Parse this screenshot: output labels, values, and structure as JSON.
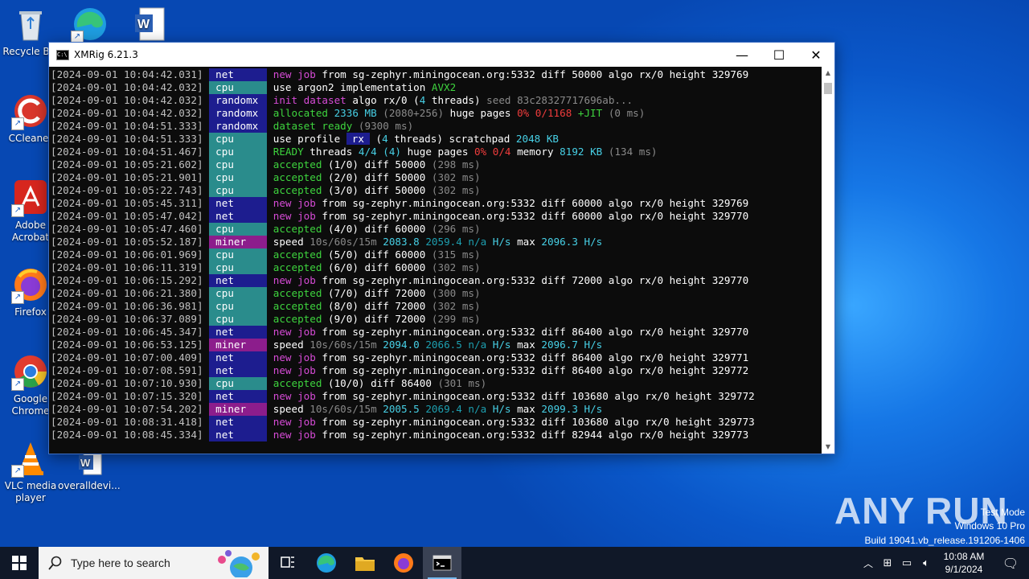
{
  "desktop": {
    "icons": [
      {
        "label": "Recycle Bin"
      },
      {
        "label": ""
      },
      {
        "label": ""
      },
      {
        "label": "CCleaner"
      },
      {
        "label": "Adobe Acrobat"
      },
      {
        "label": "Firefox"
      },
      {
        "label": "Google Chrome"
      },
      {
        "label": "VLC media player"
      },
      {
        "label": "overalldevi..."
      }
    ]
  },
  "window": {
    "title": "XMRig 6.21.3",
    "minimize": "—",
    "maximize": "☐",
    "close": "✕"
  },
  "log": [
    {
      "ts": "[2024-09-01 10:04:42.031]",
      "tag": "net",
      "parts": [
        [
          "new job",
          "mag"
        ],
        [
          " from sg-zephyr.miningocean.org:5332 diff ",
          "wht"
        ],
        [
          "50000",
          "wht"
        ],
        [
          " algo rx/0 height ",
          "wht"
        ],
        [
          "329769",
          "wht"
        ]
      ]
    },
    {
      "ts": "[2024-09-01 10:04:42.032]",
      "tag": "cpu",
      "parts": [
        [
          "use argon2 implementation ",
          "wht"
        ],
        [
          "AVX2",
          "grn"
        ]
      ]
    },
    {
      "ts": "[2024-09-01 10:04:42.032]",
      "tag": "randomx",
      "parts": [
        [
          "init dataset",
          "mag"
        ],
        [
          " algo rx/0 (",
          "wht"
        ],
        [
          "4",
          "cyn"
        ],
        [
          " threads) ",
          "wht"
        ],
        [
          "seed 83c28327717696ab...",
          "gry"
        ]
      ]
    },
    {
      "ts": "[2024-09-01 10:04:42.032]",
      "tag": "randomx",
      "parts": [
        [
          "allocated ",
          "grn"
        ],
        [
          "2336 MB",
          "cyn"
        ],
        [
          " (2080+256)",
          "gry"
        ],
        [
          " huge pages ",
          "wht"
        ],
        [
          "0% 0/1168",
          "red"
        ],
        [
          " +JIT",
          "grn"
        ],
        [
          " (0 ms)",
          "gry"
        ]
      ]
    },
    {
      "ts": "[2024-09-01 10:04:51.333]",
      "tag": "randomx",
      "parts": [
        [
          "dataset ready",
          "grn"
        ],
        [
          " (9300 ms)",
          "gry"
        ]
      ]
    },
    {
      "ts": "[2024-09-01 10:04:51.333]",
      "tag": "cpu",
      "parts": [
        [
          "use profile ",
          "wht"
        ],
        [
          "rx",
          "box"
        ],
        [
          " (",
          "wht"
        ],
        [
          "4",
          "cyn"
        ],
        [
          " threads) scratchpad ",
          "wht"
        ],
        [
          "2048 KB",
          "cyn"
        ]
      ]
    },
    {
      "ts": "[2024-09-01 10:04:51.467]",
      "tag": "cpu",
      "parts": [
        [
          "READY",
          "grn"
        ],
        [
          " threads ",
          "wht"
        ],
        [
          "4/4 (4)",
          "cyn"
        ],
        [
          " huge pages ",
          "wht"
        ],
        [
          "0% 0/4",
          "red"
        ],
        [
          " memory ",
          "wht"
        ],
        [
          "8192 KB",
          "cyn"
        ],
        [
          " (134 ms)",
          "gry"
        ]
      ]
    },
    {
      "ts": "[2024-09-01 10:05:21.602]",
      "tag": "cpu",
      "parts": [
        [
          "accepted",
          "grn"
        ],
        [
          " (1/0) diff ",
          "wht"
        ],
        [
          "50000",
          "wht"
        ],
        [
          " (298 ms)",
          "gry"
        ]
      ]
    },
    {
      "ts": "[2024-09-01 10:05:21.901]",
      "tag": "cpu",
      "parts": [
        [
          "accepted",
          "grn"
        ],
        [
          " (2/0) diff ",
          "wht"
        ],
        [
          "50000",
          "wht"
        ],
        [
          " (302 ms)",
          "gry"
        ]
      ]
    },
    {
      "ts": "[2024-09-01 10:05:22.743]",
      "tag": "cpu",
      "parts": [
        [
          "accepted",
          "grn"
        ],
        [
          " (3/0) diff ",
          "wht"
        ],
        [
          "50000",
          "wht"
        ],
        [
          " (302 ms)",
          "gry"
        ]
      ]
    },
    {
      "ts": "[2024-09-01 10:05:45.311]",
      "tag": "net",
      "parts": [
        [
          "new job",
          "mag"
        ],
        [
          " from sg-zephyr.miningocean.org:5332 diff ",
          "wht"
        ],
        [
          "60000",
          "wht"
        ],
        [
          " algo rx/0 height ",
          "wht"
        ],
        [
          "329769",
          "wht"
        ]
      ]
    },
    {
      "ts": "[2024-09-01 10:05:47.042]",
      "tag": "net",
      "parts": [
        [
          "new job",
          "mag"
        ],
        [
          " from sg-zephyr.miningocean.org:5332 diff ",
          "wht"
        ],
        [
          "60000",
          "wht"
        ],
        [
          " algo rx/0 height ",
          "wht"
        ],
        [
          "329770",
          "wht"
        ]
      ]
    },
    {
      "ts": "[2024-09-01 10:05:47.460]",
      "tag": "cpu",
      "parts": [
        [
          "accepted",
          "grn"
        ],
        [
          " (4/0) diff ",
          "wht"
        ],
        [
          "60000",
          "wht"
        ],
        [
          " (296 ms)",
          "gry"
        ]
      ]
    },
    {
      "ts": "[2024-09-01 10:05:52.187]",
      "tag": "miner",
      "parts": [
        [
          "speed ",
          "wht"
        ],
        [
          "10s/60s/15m ",
          "gry"
        ],
        [
          "2083.8",
          "cyn"
        ],
        [
          " 2059.4 n/a",
          "dcy"
        ],
        [
          " H/s",
          "cyn"
        ],
        [
          " max ",
          "wht"
        ],
        [
          "2096.3 H/s",
          "cyn"
        ]
      ]
    },
    {
      "ts": "[2024-09-01 10:06:01.969]",
      "tag": "cpu",
      "parts": [
        [
          "accepted",
          "grn"
        ],
        [
          " (5/0) diff ",
          "wht"
        ],
        [
          "60000",
          "wht"
        ],
        [
          " (315 ms)",
          "gry"
        ]
      ]
    },
    {
      "ts": "[2024-09-01 10:06:11.319]",
      "tag": "cpu",
      "parts": [
        [
          "accepted",
          "grn"
        ],
        [
          " (6/0) diff ",
          "wht"
        ],
        [
          "60000",
          "wht"
        ],
        [
          " (302 ms)",
          "gry"
        ]
      ]
    },
    {
      "ts": "[2024-09-01 10:06:15.292]",
      "tag": "net",
      "parts": [
        [
          "new job",
          "mag"
        ],
        [
          " from sg-zephyr.miningocean.org:5332 diff ",
          "wht"
        ],
        [
          "72000",
          "wht"
        ],
        [
          " algo rx/0 height ",
          "wht"
        ],
        [
          "329770",
          "wht"
        ]
      ]
    },
    {
      "ts": "[2024-09-01 10:06:21.380]",
      "tag": "cpu",
      "parts": [
        [
          "accepted",
          "grn"
        ],
        [
          " (7/0) diff ",
          "wht"
        ],
        [
          "72000",
          "wht"
        ],
        [
          " (300 ms)",
          "gry"
        ]
      ]
    },
    {
      "ts": "[2024-09-01 10:06:36.981]",
      "tag": "cpu",
      "parts": [
        [
          "accepted",
          "grn"
        ],
        [
          " (8/0) diff ",
          "wht"
        ],
        [
          "72000",
          "wht"
        ],
        [
          " (302 ms)",
          "gry"
        ]
      ]
    },
    {
      "ts": "[2024-09-01 10:06:37.089]",
      "tag": "cpu",
      "parts": [
        [
          "accepted",
          "grn"
        ],
        [
          " (9/0) diff ",
          "wht"
        ],
        [
          "72000",
          "wht"
        ],
        [
          " (299 ms)",
          "gry"
        ]
      ]
    },
    {
      "ts": "[2024-09-01 10:06:45.347]",
      "tag": "net",
      "parts": [
        [
          "new job",
          "mag"
        ],
        [
          " from sg-zephyr.miningocean.org:5332 diff ",
          "wht"
        ],
        [
          "86400",
          "wht"
        ],
        [
          " algo rx/0 height ",
          "wht"
        ],
        [
          "329770",
          "wht"
        ]
      ]
    },
    {
      "ts": "[2024-09-01 10:06:53.125]",
      "tag": "miner",
      "parts": [
        [
          "speed ",
          "wht"
        ],
        [
          "10s/60s/15m ",
          "gry"
        ],
        [
          "2094.0",
          "cyn"
        ],
        [
          " 2066.5 n/a",
          "dcy"
        ],
        [
          " H/s",
          "cyn"
        ],
        [
          " max ",
          "wht"
        ],
        [
          "2096.7 H/s",
          "cyn"
        ]
      ]
    },
    {
      "ts": "[2024-09-01 10:07:00.409]",
      "tag": "net",
      "parts": [
        [
          "new job",
          "mag"
        ],
        [
          " from sg-zephyr.miningocean.org:5332 diff ",
          "wht"
        ],
        [
          "86400",
          "wht"
        ],
        [
          " algo rx/0 height ",
          "wht"
        ],
        [
          "329771",
          "wht"
        ]
      ]
    },
    {
      "ts": "[2024-09-01 10:07:08.591]",
      "tag": "net",
      "parts": [
        [
          "new job",
          "mag"
        ],
        [
          " from sg-zephyr.miningocean.org:5332 diff ",
          "wht"
        ],
        [
          "86400",
          "wht"
        ],
        [
          " algo rx/0 height ",
          "wht"
        ],
        [
          "329772",
          "wht"
        ]
      ]
    },
    {
      "ts": "[2024-09-01 10:07:10.930]",
      "tag": "cpu",
      "parts": [
        [
          "accepted",
          "grn"
        ],
        [
          " (10/0) diff ",
          "wht"
        ],
        [
          "86400",
          "wht"
        ],
        [
          " (301 ms)",
          "gry"
        ]
      ]
    },
    {
      "ts": "[2024-09-01 10:07:15.320]",
      "tag": "net",
      "parts": [
        [
          "new job",
          "mag"
        ],
        [
          " from sg-zephyr.miningocean.org:5332 diff ",
          "wht"
        ],
        [
          "103680",
          "wht"
        ],
        [
          " algo rx/0 height ",
          "wht"
        ],
        [
          "329772",
          "wht"
        ]
      ]
    },
    {
      "ts": "[2024-09-01 10:07:54.202]",
      "tag": "miner",
      "parts": [
        [
          "speed ",
          "wht"
        ],
        [
          "10s/60s/15m ",
          "gry"
        ],
        [
          "2005.5",
          "cyn"
        ],
        [
          " 2069.4 n/a",
          "dcy"
        ],
        [
          " H/s",
          "cyn"
        ],
        [
          " max ",
          "wht"
        ],
        [
          "2099.3 H/s",
          "cyn"
        ]
      ]
    },
    {
      "ts": "[2024-09-01 10:08:31.418]",
      "tag": "net",
      "parts": [
        [
          "new job",
          "mag"
        ],
        [
          " from sg-zephyr.miningocean.org:5332 diff ",
          "wht"
        ],
        [
          "103680",
          "wht"
        ],
        [
          " algo rx/0 height ",
          "wht"
        ],
        [
          "329773",
          "wht"
        ]
      ]
    },
    {
      "ts": "[2024-09-01 10:08:45.334]",
      "tag": "net",
      "parts": [
        [
          "new job",
          "mag"
        ],
        [
          " from sg-zephyr.miningocean.org:5332 diff ",
          "wht"
        ],
        [
          "82944",
          "wht"
        ],
        [
          " algo rx/0 height ",
          "wht"
        ],
        [
          "329773",
          "wht"
        ]
      ]
    }
  ],
  "watermark": {
    "brand": "ANY RUN",
    "line1": "Test Mode",
    "line2": "Windows 10 Pro",
    "line3": "Build 19041.vb_release.191206-1406"
  },
  "taskbar": {
    "search_placeholder": "Type here to search",
    "pinned": [
      "task-view-icon",
      "edge-icon",
      "file-explorer-icon",
      "firefox-icon",
      "terminal-icon"
    ],
    "clock_time": "10:08 AM",
    "clock_date": "9/1/2024"
  },
  "colors": {
    "net_tag": "#1d1d8f",
    "cpu_tag": "#2a8c8c",
    "miner_tag": "#8c1d8c",
    "desktop_blue": "#0a57c9"
  }
}
